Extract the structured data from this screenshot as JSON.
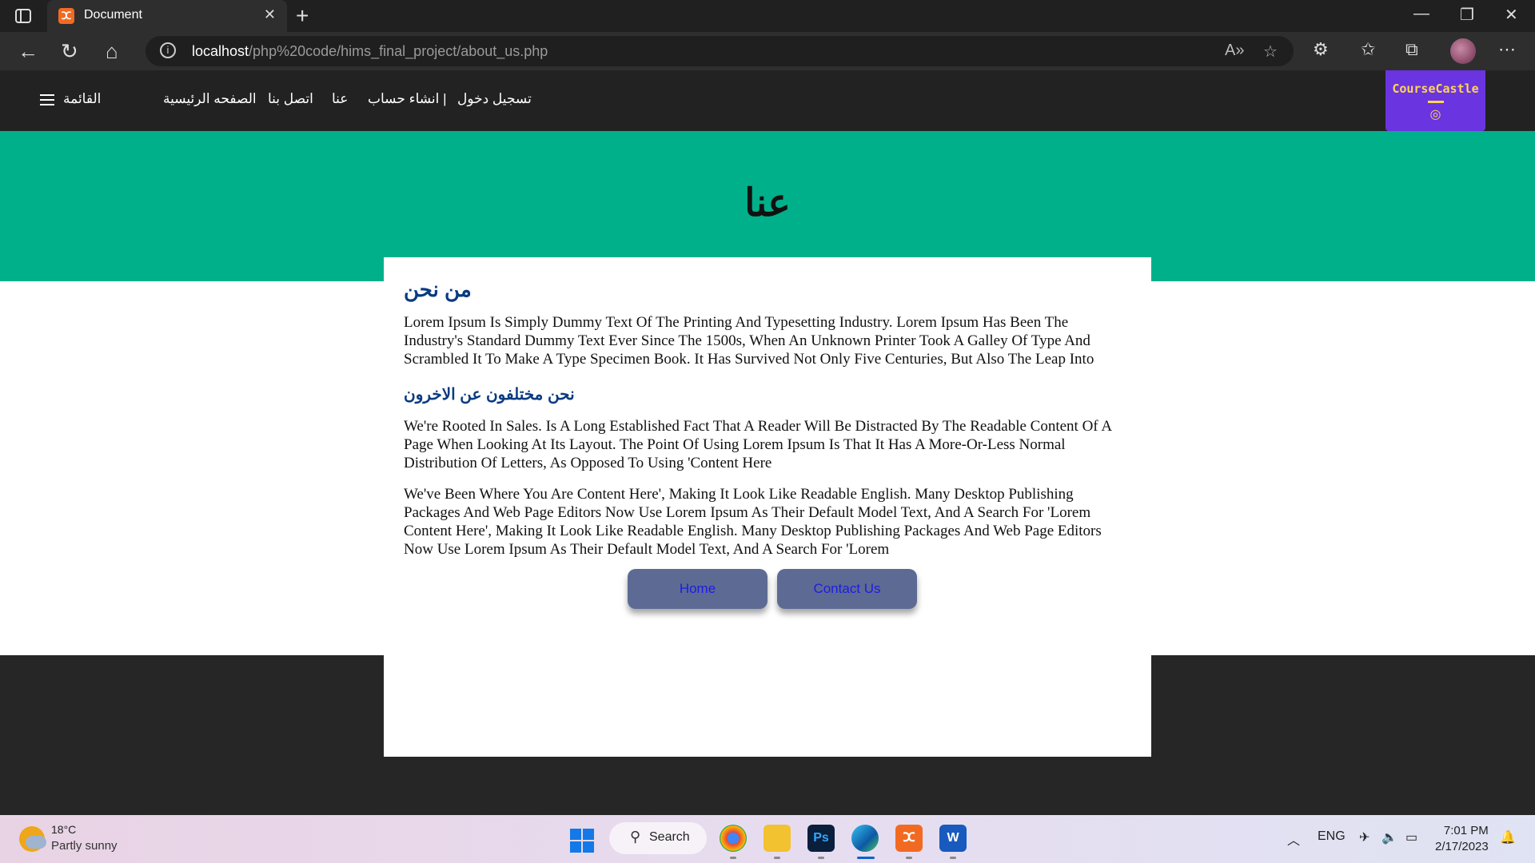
{
  "browser": {
    "tab_title": "Document",
    "url_host": "localhost",
    "url_path": "/php%20code/hims_final_project/about_us.php"
  },
  "site": {
    "logo": "CourseCastle",
    "nav": {
      "login": "تسجيل دخول",
      "register": "| انشاء حساب",
      "about": "عنا",
      "contact": "اتصل بنا",
      "home": "الصفحه الرئيسية",
      "menu": "القائمة"
    },
    "hero_title": "عنا",
    "about_heading": "من نحن",
    "about_text": "Lorem Ipsum Is Simply Dummy Text Of The Printing And Typesetting Industry. Lorem Ipsum Has Been The Industry's Standard Dummy Text Ever Since The 1500s, When An Unknown Printer Took A Galley Of Type And Scrambled It To Make A Type Specimen Book. It Has Survived Not Only Five Centuries, But Also The Leap Into",
    "diff_heading": "نحن مختلفون عن الاخرون",
    "diff_text_1": "We're Rooted In Sales. Is A Long Established Fact That A Reader Will Be Distracted By The Readable Content Of A Page When Looking At Its Layout. The Point Of Using Lorem Ipsum Is That It Has A More-Or-Less Normal Distribution Of Letters, As Opposed To Using 'Content Here",
    "diff_text_2": "We've Been Where You Are Content Here', Making It Look Like Readable English. Many Desktop Publishing Packages And Web Page Editors Now Use Lorem Ipsum As Their Default Model Text, And A Search For 'Lorem Content Here', Making It Look Like Readable English. Many Desktop Publishing Packages And Web Page Editors Now Use Lorem Ipsum As Their Default Model Text, And A Search For 'Lorem",
    "btn_home": "Home",
    "btn_contact": "Contact Us"
  },
  "taskbar": {
    "temp": "18°C",
    "weather": "Partly sunny",
    "search": "Search",
    "lang": "ENG",
    "time": "7:01 PM",
    "date": "2/17/2023"
  }
}
